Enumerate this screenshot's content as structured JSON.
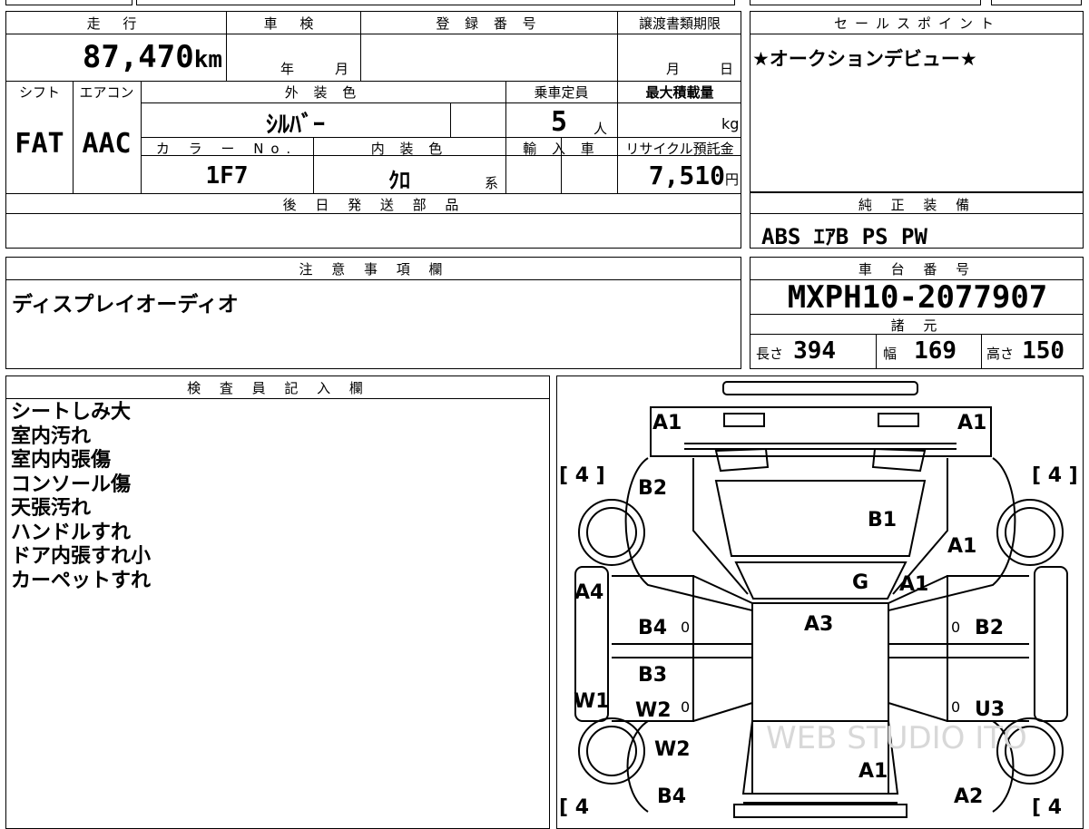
{
  "vehicle": {
    "mileage_label": "走 行",
    "mileage": "87,470",
    "mileage_unit": "km",
    "shaken_label": "車 検",
    "shaken_year_unit": "年",
    "shaken_month_unit": "月",
    "reg_number_label": "登 録 番 号",
    "transfer_deadline_label": "譲渡書類期限",
    "transfer_month_unit": "月",
    "transfer_day_unit": "日",
    "shift_label": "シフト",
    "shift": "FAT",
    "aircon_label": "エアコン",
    "aircon": "AAC",
    "exterior_color_label": "外 装 色",
    "exterior_color": "ｼﾙﾊﾞｰ",
    "capacity_label": "乗車定員",
    "capacity": "5",
    "capacity_unit": "人",
    "max_load_label": "最大積載量",
    "max_load_unit": "kg",
    "color_no_label": "カ ラ ー No.",
    "color_no": "1F7",
    "interior_color_label": "内 装 色",
    "interior_color": "ｸﾛ",
    "interior_color_suffix": "系",
    "import_label": "輸 入 車",
    "recycle_label": "リサイクル預託金",
    "recycle": "7,510",
    "recycle_unit": "円",
    "later_parts_label": "後 日 発 送 部 品"
  },
  "sales_point": {
    "label": "セールスポイント",
    "text": "★オークションデビュー★"
  },
  "equipment": {
    "label": "純 正 装 備",
    "text": "ABS ｴｱB PS PW"
  },
  "notes": {
    "label": "注 意 事 項 欄",
    "text": "ディスプレイオーディオ"
  },
  "chassis": {
    "label": "車 台 番 号",
    "number": "MXPH10-2077907",
    "spec_label": "諸 元",
    "length_label": "長さ",
    "length": "394",
    "width_label": "幅",
    "width": "169",
    "height_label": "高さ",
    "height": "150"
  },
  "inspector": {
    "label": "検 査 員 記 入 欄",
    "lines": [
      "シートしみ大",
      "室内汚れ",
      "室内内張傷",
      "コンソール傷",
      "天張汚れ",
      "ハンドルすれ",
      "ドア内張すれ小",
      "カーペットすれ"
    ]
  },
  "diagram": {
    "tire_tl": "[ 4 ]",
    "tire_tr": "[ 4 ]",
    "tire_bl": "[ 4",
    "tire_br": "[ 4",
    "marks": [
      "A1",
      "A1",
      "B2",
      "B1",
      "A1",
      "G",
      "A1",
      "A4",
      "B4",
      "0",
      "A3",
      "0",
      "B2",
      "B3",
      "W1",
      "W2",
      "0",
      "0",
      "U3",
      "W2",
      "A1",
      "B4",
      "A2"
    ],
    "watermark": "WEB STUDIO ITO"
  }
}
